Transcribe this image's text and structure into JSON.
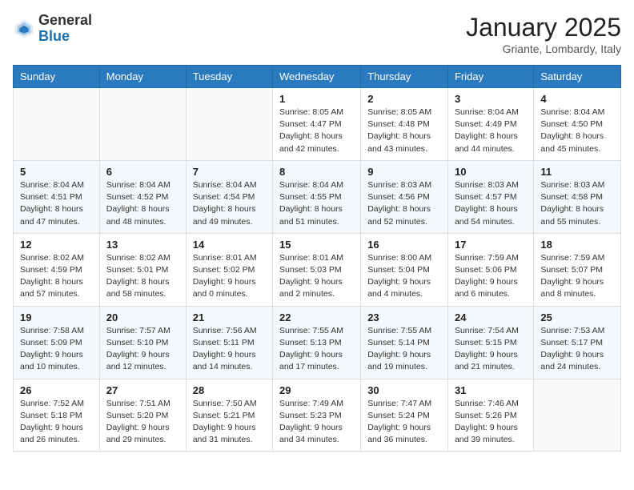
{
  "header": {
    "logo_general": "General",
    "logo_blue": "Blue",
    "month": "January 2025",
    "location": "Griante, Lombardy, Italy"
  },
  "days_of_week": [
    "Sunday",
    "Monday",
    "Tuesday",
    "Wednesday",
    "Thursday",
    "Friday",
    "Saturday"
  ],
  "weeks": [
    [
      {
        "day": "",
        "info": ""
      },
      {
        "day": "",
        "info": ""
      },
      {
        "day": "",
        "info": ""
      },
      {
        "day": "1",
        "info": "Sunrise: 8:05 AM\nSunset: 4:47 PM\nDaylight: 8 hours and 42 minutes."
      },
      {
        "day": "2",
        "info": "Sunrise: 8:05 AM\nSunset: 4:48 PM\nDaylight: 8 hours and 43 minutes."
      },
      {
        "day": "3",
        "info": "Sunrise: 8:04 AM\nSunset: 4:49 PM\nDaylight: 8 hours and 44 minutes."
      },
      {
        "day": "4",
        "info": "Sunrise: 8:04 AM\nSunset: 4:50 PM\nDaylight: 8 hours and 45 minutes."
      }
    ],
    [
      {
        "day": "5",
        "info": "Sunrise: 8:04 AM\nSunset: 4:51 PM\nDaylight: 8 hours and 47 minutes."
      },
      {
        "day": "6",
        "info": "Sunrise: 8:04 AM\nSunset: 4:52 PM\nDaylight: 8 hours and 48 minutes."
      },
      {
        "day": "7",
        "info": "Sunrise: 8:04 AM\nSunset: 4:54 PM\nDaylight: 8 hours and 49 minutes."
      },
      {
        "day": "8",
        "info": "Sunrise: 8:04 AM\nSunset: 4:55 PM\nDaylight: 8 hours and 51 minutes."
      },
      {
        "day": "9",
        "info": "Sunrise: 8:03 AM\nSunset: 4:56 PM\nDaylight: 8 hours and 52 minutes."
      },
      {
        "day": "10",
        "info": "Sunrise: 8:03 AM\nSunset: 4:57 PM\nDaylight: 8 hours and 54 minutes."
      },
      {
        "day": "11",
        "info": "Sunrise: 8:03 AM\nSunset: 4:58 PM\nDaylight: 8 hours and 55 minutes."
      }
    ],
    [
      {
        "day": "12",
        "info": "Sunrise: 8:02 AM\nSunset: 4:59 PM\nDaylight: 8 hours and 57 minutes."
      },
      {
        "day": "13",
        "info": "Sunrise: 8:02 AM\nSunset: 5:01 PM\nDaylight: 8 hours and 58 minutes."
      },
      {
        "day": "14",
        "info": "Sunrise: 8:01 AM\nSunset: 5:02 PM\nDaylight: 9 hours and 0 minutes."
      },
      {
        "day": "15",
        "info": "Sunrise: 8:01 AM\nSunset: 5:03 PM\nDaylight: 9 hours and 2 minutes."
      },
      {
        "day": "16",
        "info": "Sunrise: 8:00 AM\nSunset: 5:04 PM\nDaylight: 9 hours and 4 minutes."
      },
      {
        "day": "17",
        "info": "Sunrise: 7:59 AM\nSunset: 5:06 PM\nDaylight: 9 hours and 6 minutes."
      },
      {
        "day": "18",
        "info": "Sunrise: 7:59 AM\nSunset: 5:07 PM\nDaylight: 9 hours and 8 minutes."
      }
    ],
    [
      {
        "day": "19",
        "info": "Sunrise: 7:58 AM\nSunset: 5:09 PM\nDaylight: 9 hours and 10 minutes."
      },
      {
        "day": "20",
        "info": "Sunrise: 7:57 AM\nSunset: 5:10 PM\nDaylight: 9 hours and 12 minutes."
      },
      {
        "day": "21",
        "info": "Sunrise: 7:56 AM\nSunset: 5:11 PM\nDaylight: 9 hours and 14 minutes."
      },
      {
        "day": "22",
        "info": "Sunrise: 7:55 AM\nSunset: 5:13 PM\nDaylight: 9 hours and 17 minutes."
      },
      {
        "day": "23",
        "info": "Sunrise: 7:55 AM\nSunset: 5:14 PM\nDaylight: 9 hours and 19 minutes."
      },
      {
        "day": "24",
        "info": "Sunrise: 7:54 AM\nSunset: 5:15 PM\nDaylight: 9 hours and 21 minutes."
      },
      {
        "day": "25",
        "info": "Sunrise: 7:53 AM\nSunset: 5:17 PM\nDaylight: 9 hours and 24 minutes."
      }
    ],
    [
      {
        "day": "26",
        "info": "Sunrise: 7:52 AM\nSunset: 5:18 PM\nDaylight: 9 hours and 26 minutes."
      },
      {
        "day": "27",
        "info": "Sunrise: 7:51 AM\nSunset: 5:20 PM\nDaylight: 9 hours and 29 minutes."
      },
      {
        "day": "28",
        "info": "Sunrise: 7:50 AM\nSunset: 5:21 PM\nDaylight: 9 hours and 31 minutes."
      },
      {
        "day": "29",
        "info": "Sunrise: 7:49 AM\nSunset: 5:23 PM\nDaylight: 9 hours and 34 minutes."
      },
      {
        "day": "30",
        "info": "Sunrise: 7:47 AM\nSunset: 5:24 PM\nDaylight: 9 hours and 36 minutes."
      },
      {
        "day": "31",
        "info": "Sunrise: 7:46 AM\nSunset: 5:26 PM\nDaylight: 9 hours and 39 minutes."
      },
      {
        "day": "",
        "info": ""
      }
    ]
  ]
}
